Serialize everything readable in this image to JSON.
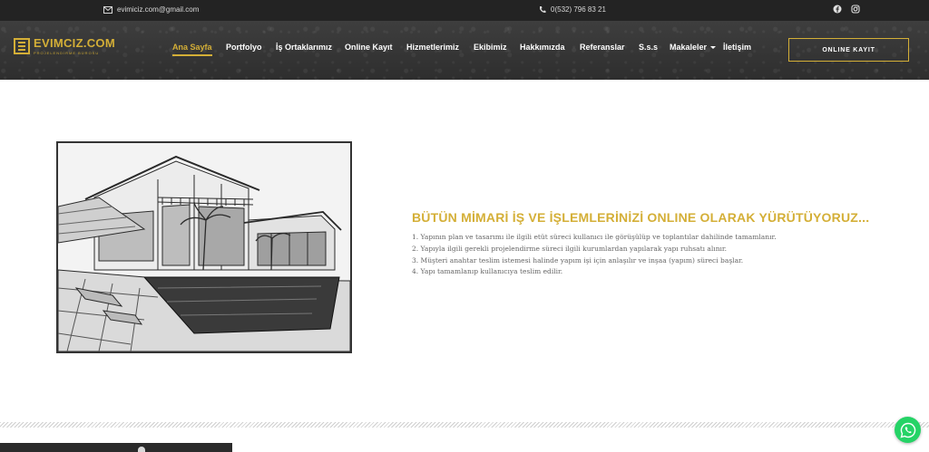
{
  "topbar": {
    "email": "evimiciz.com@gmail.com",
    "phone": "0(532) 796 83 21",
    "socials": [
      {
        "icon": "facebook-icon"
      },
      {
        "icon": "instagram-icon"
      }
    ]
  },
  "header": {
    "logo": {
      "text": "EVIMCIZ.COM",
      "tagline": "PROJELENDİRME BÜROSU"
    },
    "nav": [
      {
        "label": "Ana Sayfa",
        "active": true
      },
      {
        "label": "Portfolyo"
      },
      {
        "label": "İş Ortaklarımız"
      },
      {
        "label": "Online Kayıt"
      },
      {
        "label": "Hizmetlerimiz"
      },
      {
        "label": "Ekibimiz"
      },
      {
        "label": "Hakkımızda"
      },
      {
        "label": "Referanslar"
      },
      {
        "label": "S.s.s"
      },
      {
        "label": "Makaleler",
        "dropdown": true
      },
      {
        "label": "İletişim"
      }
    ],
    "cta_label": "ONLINE KAYIT"
  },
  "content": {
    "headline": "BÜTÜN MİMARİ İŞ VE İŞLEMLERİNİZİ ONLINE OLARAK YÜRÜTÜYORUZ...",
    "steps": [
      "1. Yapının plan ve tasarımı ile ilgili etüt süreci kullanıcı ile görüşülüp ve toplantılar dahilinde tamamlanır.",
      "2. Yapıyla ilgili gerekli projelendirme süreci ilgili kurumlardan yapılarak yapı ruhsatı alınır.",
      "3. Müşteri anahtar teslim istemesi halinde yapım işi için anlaşılır ve inşaa (yapım) süreci başlar.",
      "4. Yapı tamamlanıp kullanıcıya teslim edilir."
    ]
  },
  "colors": {
    "accent": "#d4af37",
    "topbar": "#232323",
    "header": "#3a3a3a",
    "whatsapp": "#25d366"
  }
}
